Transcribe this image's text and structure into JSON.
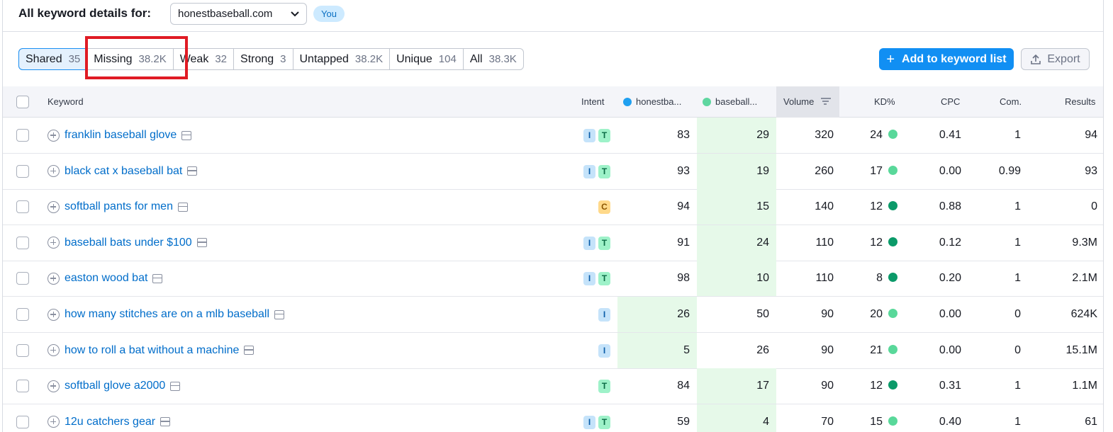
{
  "header": {
    "title": "All keyword details for:",
    "domain": "honestbaseball.com",
    "you_badge": "You"
  },
  "tabs": [
    {
      "label": "Shared",
      "count": "35"
    },
    {
      "label": "Missing",
      "count": "38.2K"
    },
    {
      "label": "Weak",
      "count": "32"
    },
    {
      "label": "Strong",
      "count": "3"
    },
    {
      "label": "Untapped",
      "count": "38.2K"
    },
    {
      "label": "Unique",
      "count": "104"
    },
    {
      "label": "All",
      "count": "38.3K"
    }
  ],
  "actions": {
    "add_label": "Add to keyword list",
    "export_label": "Export"
  },
  "table": {
    "headers": {
      "keyword": "Keyword",
      "intent": "Intent",
      "domain1": "honestba...",
      "domain2": "baseball...",
      "volume": "Volume",
      "kd": "KD%",
      "cpc": "CPC",
      "com": "Com.",
      "results": "Results"
    },
    "colors": {
      "domain1_dot": "#1fa0f0",
      "domain2_dot": "#5fd6a0",
      "kd_light": "#59d89a",
      "kd_dark": "#0b9a69"
    },
    "rows": [
      {
        "keyword": "franklin baseball glove",
        "intent": [
          "I",
          "T"
        ],
        "d1": "83",
        "d2": "29",
        "volume": "320",
        "kd": "24",
        "kd_level": "light",
        "cpc": "0.41",
        "com": "1",
        "results": "94",
        "best": "d2"
      },
      {
        "keyword": "black cat x baseball bat",
        "intent": [
          "I",
          "T"
        ],
        "d1": "93",
        "d2": "19",
        "volume": "260",
        "kd": "17",
        "kd_level": "light",
        "cpc": "0.00",
        "com": "0.99",
        "results": "93",
        "best": "d2"
      },
      {
        "keyword": "softball pants for men",
        "intent": [
          "C"
        ],
        "d1": "94",
        "d2": "15",
        "volume": "140",
        "kd": "12",
        "kd_level": "dark",
        "cpc": "0.88",
        "com": "1",
        "results": "0",
        "best": "d2"
      },
      {
        "keyword": "baseball bats under $100",
        "intent": [
          "I",
          "T"
        ],
        "d1": "91",
        "d2": "24",
        "volume": "110",
        "kd": "12",
        "kd_level": "dark",
        "cpc": "0.12",
        "com": "1",
        "results": "9.3M",
        "best": "d2"
      },
      {
        "keyword": "easton wood bat",
        "intent": [
          "I",
          "T"
        ],
        "d1": "98",
        "d2": "10",
        "volume": "110",
        "kd": "8",
        "kd_level": "dark",
        "cpc": "0.20",
        "com": "1",
        "results": "2.1M",
        "best": "d2"
      },
      {
        "keyword": "how many stitches are on a mlb baseball",
        "intent": [
          "I"
        ],
        "d1": "26",
        "d2": "50",
        "volume": "90",
        "kd": "20",
        "kd_level": "light",
        "cpc": "0.00",
        "com": "0",
        "results": "624K",
        "best": "d1"
      },
      {
        "keyword": "how to roll a bat without a machine",
        "intent": [
          "I"
        ],
        "d1": "5",
        "d2": "26",
        "volume": "90",
        "kd": "21",
        "kd_level": "light",
        "cpc": "0.00",
        "com": "0",
        "results": "15.1M",
        "best": "d1"
      },
      {
        "keyword": "softball glove a2000",
        "intent": [
          "T"
        ],
        "d1": "84",
        "d2": "17",
        "volume": "90",
        "kd": "12",
        "kd_level": "dark",
        "cpc": "0.31",
        "com": "1",
        "results": "1.1M",
        "best": "d2"
      },
      {
        "keyword": "12u catchers gear",
        "intent": [
          "I",
          "T"
        ],
        "d1": "59",
        "d2": "4",
        "volume": "70",
        "kd": "15",
        "kd_level": "light",
        "cpc": "0.40",
        "com": "1",
        "results": "61",
        "best": "d2"
      }
    ]
  }
}
